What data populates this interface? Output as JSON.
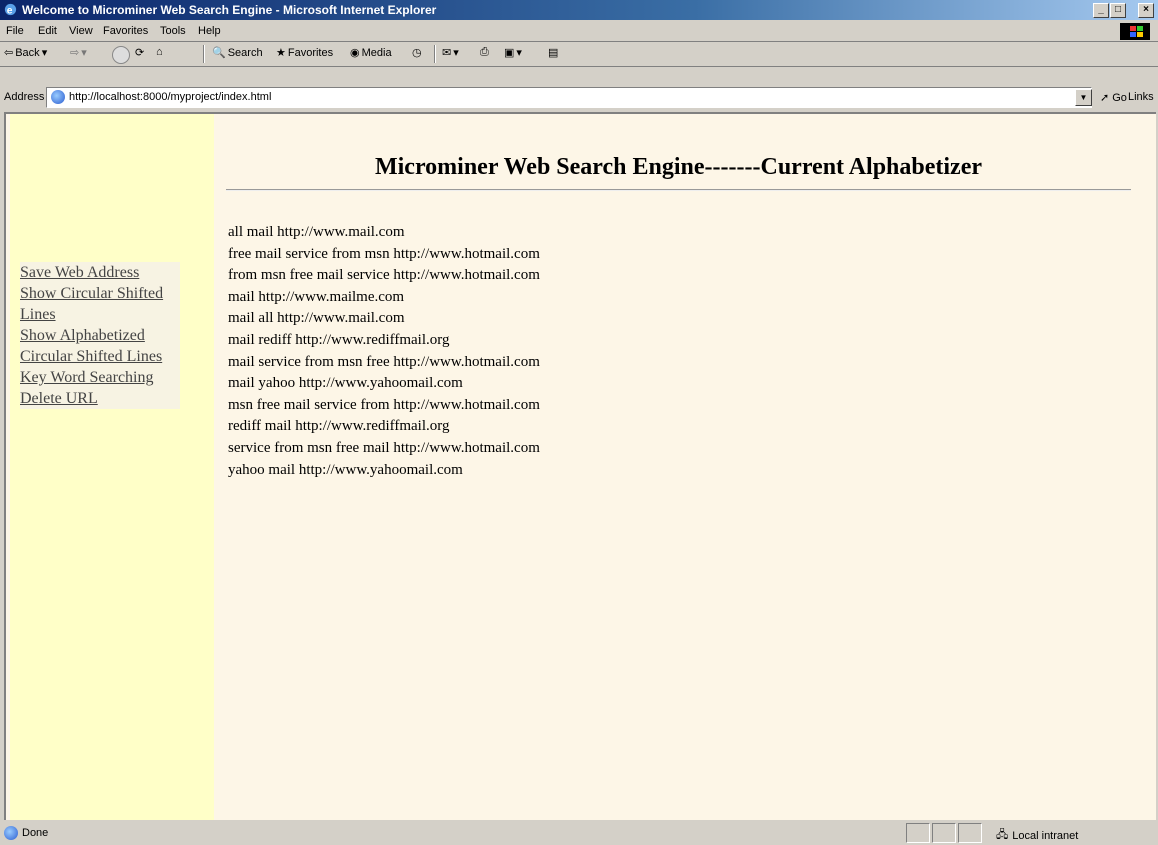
{
  "window": {
    "title": "Welcome to Microminer Web Search Engine - Microsoft Internet Explorer",
    "buttons": [
      "_",
      "□",
      "×"
    ]
  },
  "menu": [
    "File",
    "Edit",
    "View",
    "Favorites",
    "Tools",
    "Help"
  ],
  "toolbar": {
    "back": "Back",
    "search": "Search",
    "favorites": "Favorites",
    "media": "Media"
  },
  "address": {
    "label": "Address",
    "url": "http://localhost:8000/myproject/index.html",
    "go": "Go",
    "links": "Links"
  },
  "nav": [
    "Save Web Address",
    "Show Circular Shifted Lines",
    "Show Alphabetized Circular Shifted Lines",
    "Key Word Searching",
    "Delete URL"
  ],
  "main": {
    "heading": "Microminer Web Search Engine-------Current Alphabetizer",
    "lines": [
      "all mail http://www.mail.com",
      "free mail service from msn http://www.hotmail.com",
      "from msn free mail service http://www.hotmail.com",
      "mail http://www.mailme.com",
      "mail all http://www.mail.com",
      "mail rediff http://www.rediffmail.org",
      "mail service from msn free http://www.hotmail.com",
      "mail yahoo http://www.yahoomail.com",
      "msn free mail service from http://www.hotmail.com",
      "rediff mail http://www.rediffmail.org",
      "service from msn free mail http://www.hotmail.com",
      "yahoo mail http://www.yahoomail.com"
    ]
  },
  "status": {
    "text": "Done",
    "zone": "Local intranet"
  }
}
